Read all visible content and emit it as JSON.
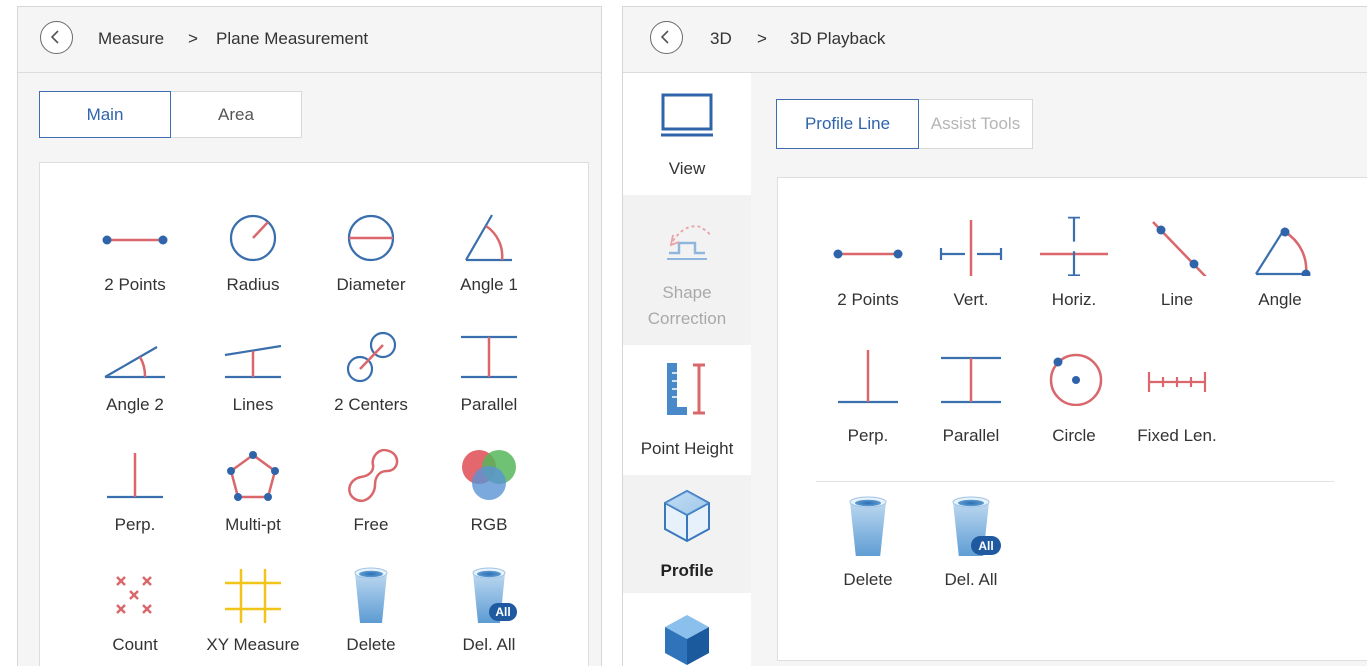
{
  "left": {
    "breadcrumb": {
      "section": "Measure",
      "separator": ">",
      "page": "Plane Measurement"
    },
    "tabs": [
      {
        "label": "Main",
        "active": true
      },
      {
        "label": "Area",
        "active": false
      }
    ],
    "tools": [
      {
        "label": "2 Points",
        "icon": "two-points-icon"
      },
      {
        "label": "Radius",
        "icon": "radius-icon"
      },
      {
        "label": "Diameter",
        "icon": "diameter-icon"
      },
      {
        "label": "Angle 1",
        "icon": "angle-1-icon"
      },
      {
        "label": "Angle 2",
        "icon": "angle-2-icon"
      },
      {
        "label": "Lines",
        "icon": "lines-icon"
      },
      {
        "label": "2 Centers",
        "icon": "two-centers-icon"
      },
      {
        "label": "Parallel",
        "icon": "parallel-icon"
      },
      {
        "label": "Perp.",
        "icon": "perpendicular-icon"
      },
      {
        "label": "Multi-pt",
        "icon": "multi-point-icon"
      },
      {
        "label": "Free",
        "icon": "free-icon"
      },
      {
        "label": "RGB",
        "icon": "rgb-icon"
      },
      {
        "label": "Count",
        "icon": "count-icon"
      },
      {
        "label": "XY Measure",
        "icon": "xy-measure-icon"
      },
      {
        "label": "Delete",
        "icon": "delete-bucket-icon"
      },
      {
        "label": "Del. All",
        "icon": "delete-all-bucket-icon",
        "badge": "All"
      }
    ]
  },
  "right": {
    "breadcrumb": {
      "section": "3D",
      "separator": ">",
      "page": "3D Playback"
    },
    "sidebar": [
      {
        "label": "View",
        "icon": "monitor-icon",
        "state": "normal"
      },
      {
        "label_line1": "Shape",
        "label_line2": "Correction",
        "icon": "shape-correction-icon",
        "state": "disabled"
      },
      {
        "label": "Point Height",
        "icon": "point-height-icon",
        "state": "normal"
      },
      {
        "label": "Profile",
        "icon": "profile-cube-icon",
        "state": "selected"
      },
      {
        "label": "",
        "icon": "solid-cube-icon",
        "state": "normal"
      }
    ],
    "tabs": [
      {
        "label": "Profile Line",
        "active": true
      },
      {
        "label": "Assist Tools",
        "active": false,
        "disabled": true
      }
    ],
    "tools": [
      {
        "label": "2 Points",
        "icon": "two-points-icon"
      },
      {
        "label": "Vert.",
        "icon": "vertical-icon"
      },
      {
        "label": "Horiz.",
        "icon": "horizontal-icon"
      },
      {
        "label": "Line",
        "icon": "line-icon"
      },
      {
        "label": "Angle",
        "icon": "angle-icon"
      },
      {
        "label": "Perp.",
        "icon": "perpendicular-icon"
      },
      {
        "label": "Parallel",
        "icon": "parallel-icon"
      },
      {
        "label": "Circle",
        "icon": "circle-icon"
      },
      {
        "label": "Fixed Len.",
        "icon": "fixed-length-icon"
      },
      {
        "label": "Delete",
        "icon": "delete-bucket-icon"
      },
      {
        "label": "Del. All",
        "icon": "delete-all-bucket-icon",
        "badge": "All"
      }
    ]
  },
  "colors": {
    "accent": "#2f64ab",
    "measure_red": "#d9676b",
    "measure_blue": "#3a6fad",
    "yellow": "#f0c419"
  }
}
